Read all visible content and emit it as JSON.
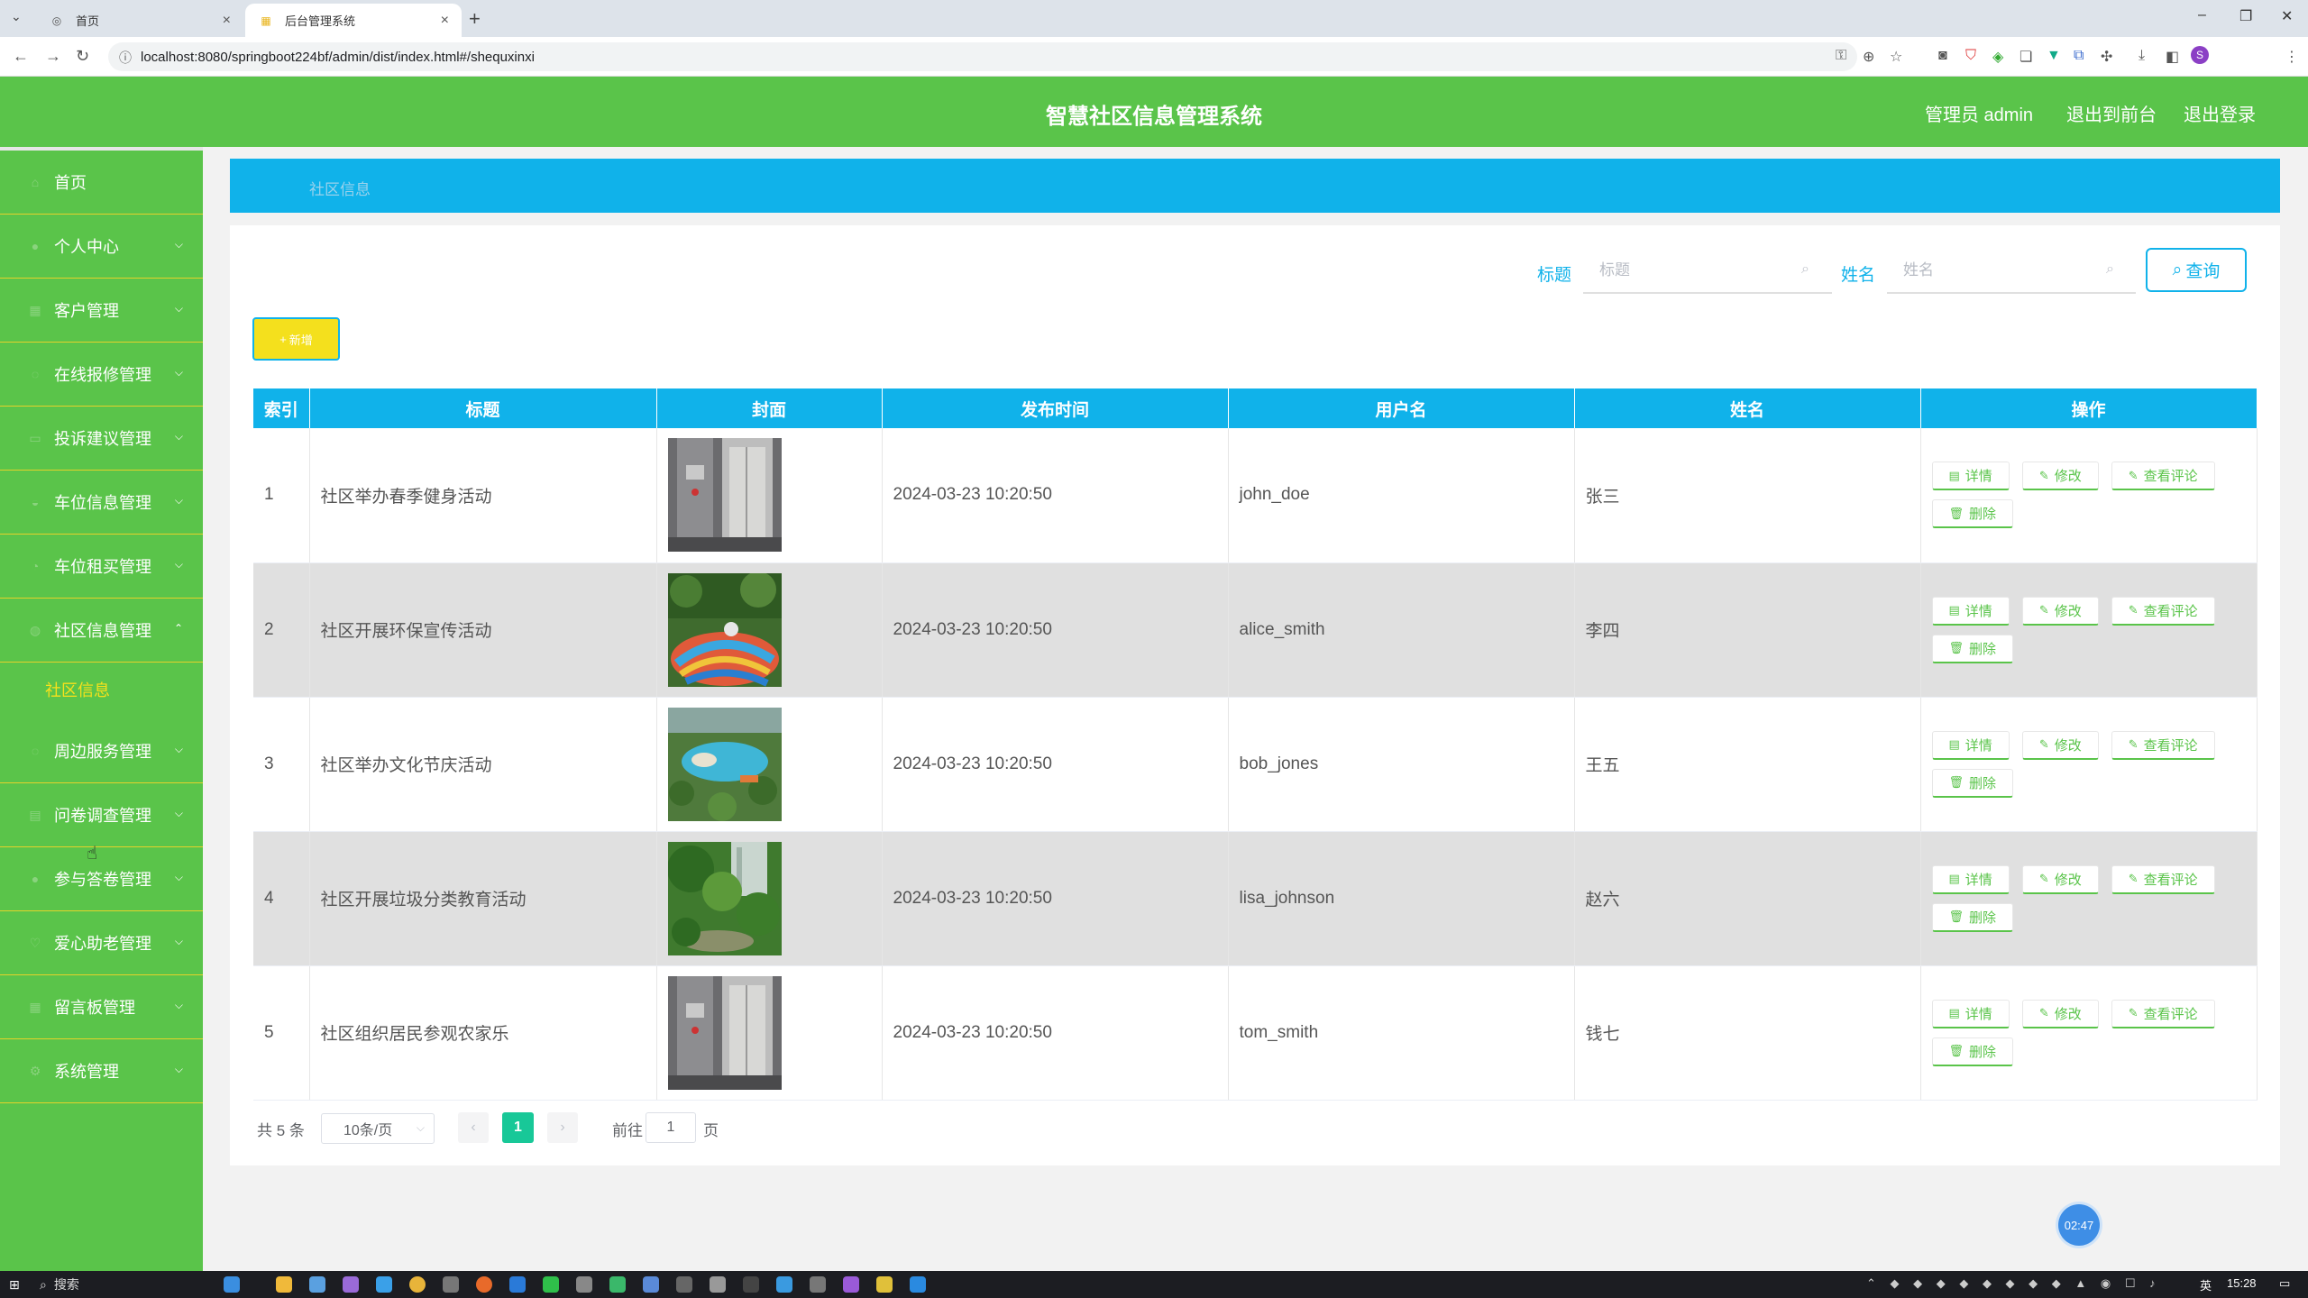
{
  "browser": {
    "tabs": [
      {
        "title": "首页",
        "active": false
      },
      {
        "title": "后台管理系统",
        "active": true
      }
    ],
    "new_tab_glyph": "+",
    "url": "localhost:8080/springboot224bf/admin/dist/index.html#/shequxinxi",
    "profile_initial": "S"
  },
  "header": {
    "title": "智慧社区信息管理系统",
    "user": "管理员 admin",
    "to_front": "退出到前台",
    "logout": "退出登录"
  },
  "sidebar": {
    "items": [
      {
        "label": "首页",
        "icon": "home-icon",
        "has_arrow": false
      },
      {
        "label": "个人中心",
        "icon": "user-icon",
        "has_arrow": true
      },
      {
        "label": "客户管理",
        "icon": "grid-icon",
        "has_arrow": true
      },
      {
        "label": "在线报修管理",
        "icon": "tool-icon",
        "has_arrow": true
      },
      {
        "label": "投诉建议管理",
        "icon": "message-icon",
        "has_arrow": true
      },
      {
        "label": "车位信息管理",
        "icon": "car-icon",
        "has_arrow": true
      },
      {
        "label": "车位租买管理",
        "icon": "cart-icon",
        "has_arrow": true
      },
      {
        "label": "社区信息管理",
        "icon": "info-icon",
        "has_arrow": true,
        "expanded": true
      }
    ],
    "submenu": {
      "label": "社区信息"
    },
    "items_after": [
      {
        "label": "周边服务管理",
        "icon": "location-icon",
        "has_arrow": true
      },
      {
        "label": "问卷调查管理",
        "icon": "survey-icon",
        "has_arrow": true
      },
      {
        "label": "参与答卷管理",
        "icon": "person-icon",
        "has_arrow": true
      },
      {
        "label": "爱心助老管理",
        "icon": "heart-icon",
        "has_arrow": true
      },
      {
        "label": "留言板管理",
        "icon": "board-icon",
        "has_arrow": true
      },
      {
        "label": "系统管理",
        "icon": "settings-icon",
        "has_arrow": true
      }
    ]
  },
  "breadcrumb": "社区信息",
  "search": {
    "title_label": "标题",
    "title_placeholder": "标题",
    "name_label": "姓名",
    "name_placeholder": "姓名",
    "query_button": "查询"
  },
  "add_button": "新增",
  "table": {
    "columns": [
      "索引",
      "标题",
      "封面",
      "发布时间",
      "用户名",
      "姓名",
      "操作"
    ],
    "rows": [
      {
        "index": "1",
        "title": "社区举办春季健身活动",
        "cover": "elevator",
        "time": "2024-03-23 10:20:50",
        "username": "john_doe",
        "name": "张三"
      },
      {
        "index": "2",
        "title": "社区开展环保宣传活动",
        "cover": "playground",
        "time": "2024-03-23 10:20:50",
        "username": "alice_smith",
        "name": "李四"
      },
      {
        "index": "3",
        "title": "社区举办文化节庆活动",
        "cover": "pool-garden",
        "time": "2024-03-23 10:20:50",
        "username": "bob_jones",
        "name": "王五"
      },
      {
        "index": "4",
        "title": "社区开展垃圾分类教育活动",
        "cover": "garden",
        "time": "2024-03-23 10:20:50",
        "username": "lisa_johnson",
        "name": "赵六"
      },
      {
        "index": "5",
        "title": "社区组织居民参观农家乐",
        "cover": "elevator",
        "time": "2024-03-23 10:20:50",
        "username": "tom_smith",
        "name": "钱七"
      }
    ],
    "actions": {
      "detail": "详情",
      "edit": "修改",
      "comments": "查看评论",
      "delete": "删除"
    }
  },
  "pagination": {
    "total": "共 5 条",
    "page_size": "10条/页",
    "current_page": "1",
    "goto_prefix": "前往",
    "goto_value": "1",
    "goto_suffix": "页"
  },
  "timer": "02:47",
  "taskbar": {
    "search": "搜索",
    "ime": "英",
    "time": "15:28"
  },
  "colors": {
    "header_green": "#5ac44a",
    "accent_blue": "#10b2ea",
    "submenu_yellow": "#f6e11b",
    "add_button_yellow": "#f4e01d",
    "page_active": "#18c898"
  }
}
